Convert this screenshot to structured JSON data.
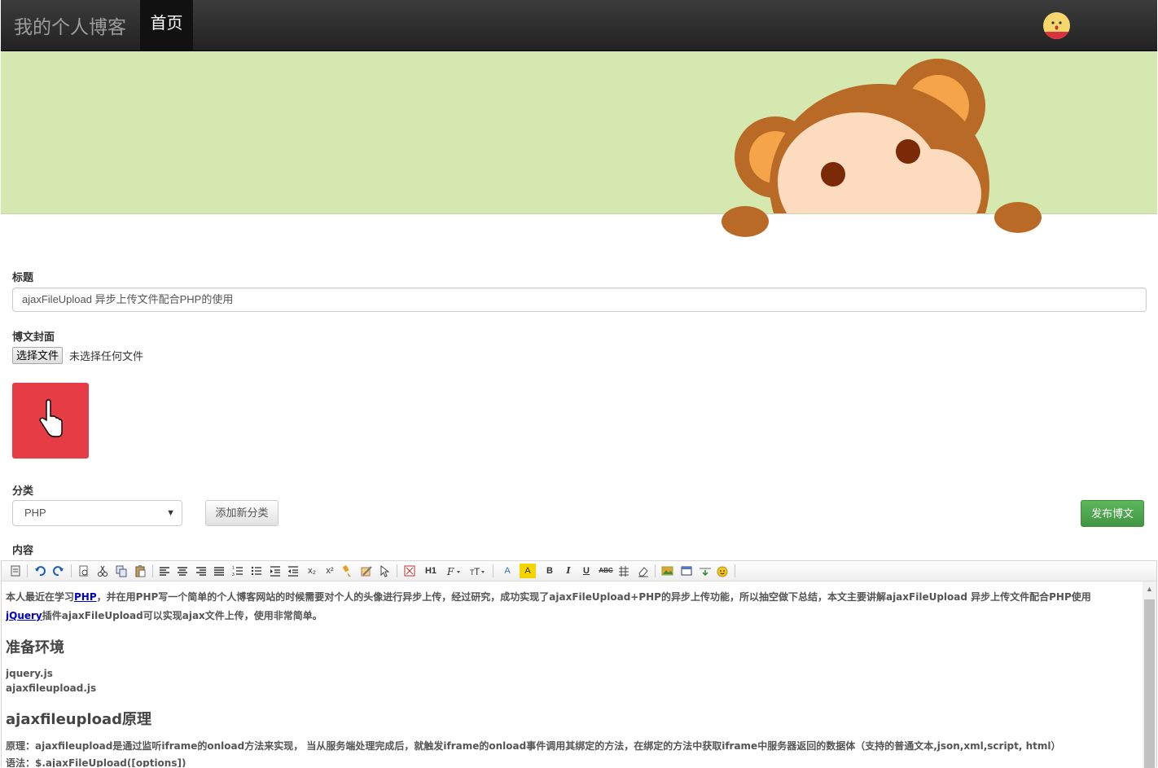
{
  "navbar": {
    "brand": "我的个人博客",
    "home": "首页"
  },
  "form": {
    "title_label": "标题",
    "title_value": "ajaxFileUpload 异步上传文件配合PHP的使用",
    "cover_label": "博文封面",
    "file_button": "选择文件",
    "file_status": "未选择任何文件",
    "category_label": "分类",
    "category_value": "PHP",
    "add_category": "添加新分类",
    "publish": "发布博文",
    "content_label": "内容"
  },
  "editor": {
    "toolbar": [
      "H1",
      "A",
      "A",
      "B",
      "I",
      "U",
      "ABC",
      "x₂",
      "x²"
    ],
    "content": {
      "p1_a": "本人最近在学习",
      "p1_link": "PHP",
      "p1_b": "，并在用PHP写一个简单的个人博客网站的时候需要对个人的头像进行异步上传，经过研究，成功实现了ajaxFileUpload+PHP的异步上传功能，所以抽空做下总结，本文主要讲解ajaxFileUpload 异步上传文件配合PHP使用",
      "p2_link": "jQuery",
      "p2_b": "插件ajaxFileUpload可以实现ajax文件上传，使用非常简单。",
      "h1": "准备环境",
      "file1": "jquery.js",
      "file2": "ajaxfileupload.js",
      "h2": "ajaxfileupload原理",
      "p3": "原理：ajaxfileupload是通过监听iframe的onload方法来实现， 当从服务端处理完成后，就触发iframe的onload事件调用其绑定的方法，在绑定的方法中获取iframe中服务器返回的数据体（支持的普通文本,json,xml,script, html）",
      "p4": "语法：$.ajaxFileUpload([options])"
    }
  }
}
